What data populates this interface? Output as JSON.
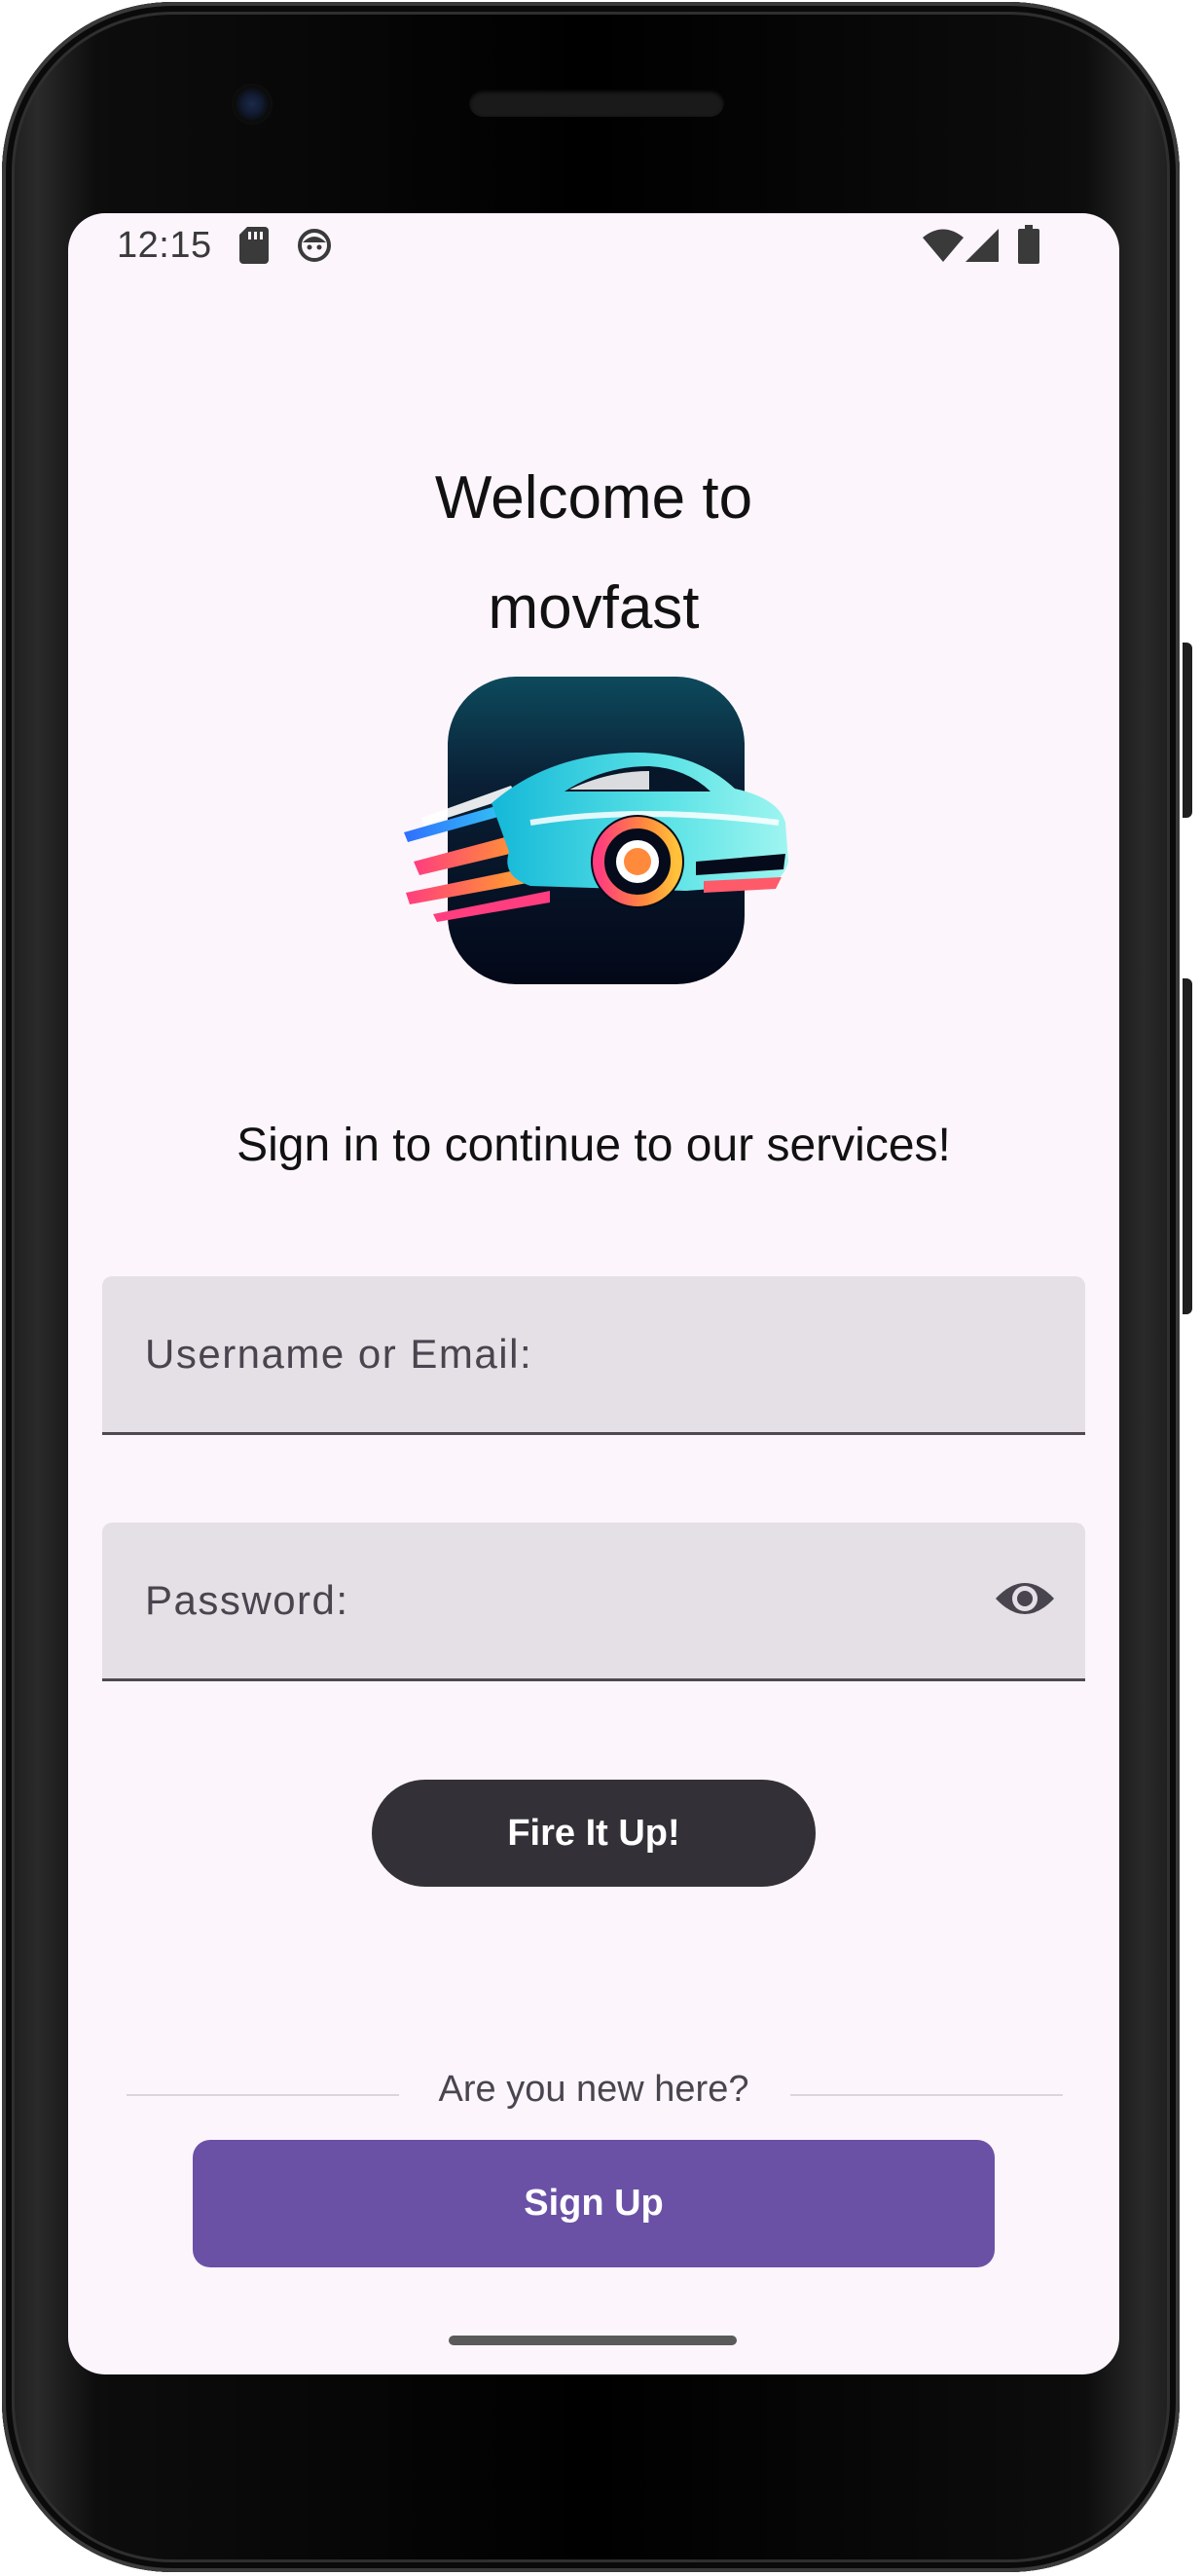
{
  "status_bar": {
    "time": "12:15",
    "left_icons": [
      "sd-card-icon",
      "android-debug-icon"
    ],
    "right_icons": [
      "wifi-icon",
      "cell-signal-icon",
      "battery-icon"
    ]
  },
  "header": {
    "title_line1": "Welcome to",
    "title_line2": "movfast"
  },
  "logo": {
    "icon": "car-logo-icon"
  },
  "subtitle": "Sign in to continue to our services!",
  "form": {
    "username_placeholder": "Username or Email:",
    "username_value": "",
    "password_placeholder": "Password:",
    "password_value": "",
    "password_toggle_icon": "eye-icon",
    "submit_label": "Fire It Up!"
  },
  "signup": {
    "prompt": "Are you new here?",
    "button_label": "Sign Up"
  },
  "colors": {
    "background": "#fcf5fc",
    "field_background": "#e5dfe6",
    "primary_button": "#333137",
    "signup_button": "#6a51a6"
  }
}
